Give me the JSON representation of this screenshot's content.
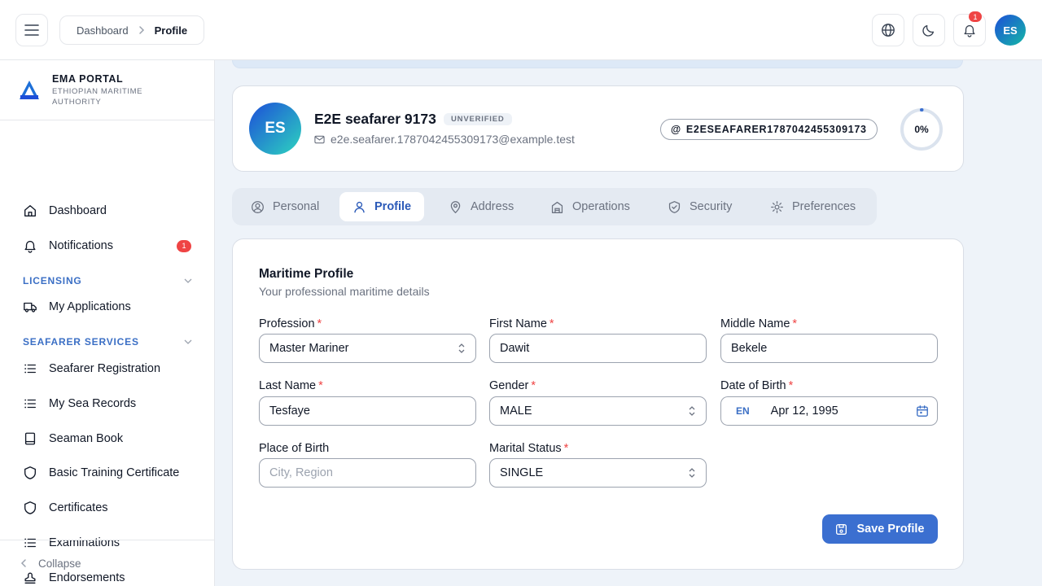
{
  "header": {
    "breadcrumb": [
      {
        "label": "Dashboard"
      },
      {
        "label": "Profile"
      }
    ],
    "notification_count": "1",
    "avatar_initials": "ES"
  },
  "sidebar": {
    "brand": {
      "name": "EMA PORTAL",
      "subtitle_line1": "ETHIOPIAN MARITIME",
      "subtitle_line2": "AUTHORITY"
    },
    "items": [
      {
        "label": "Dashboard",
        "icon": "home-icon"
      },
      {
        "label": "Notifications",
        "icon": "bell-icon",
        "badge": "1"
      },
      {
        "label": "My Applications",
        "icon": "truck-icon"
      },
      {
        "label": "Seafarer Registration",
        "icon": "list-icon"
      },
      {
        "label": "My Sea Records",
        "icon": "list-icon"
      },
      {
        "label": "Seaman Book",
        "icon": "book-icon"
      },
      {
        "label": "Basic Training Certificate",
        "icon": "shield-icon"
      },
      {
        "label": "Certificates",
        "icon": "shield-icon"
      },
      {
        "label": "Examinations",
        "icon": "list-icon"
      },
      {
        "label": "Endorsements",
        "icon": "stamp-icon"
      }
    ],
    "sections": [
      {
        "label": "LICENSING"
      },
      {
        "label": "SEAFARER SERVICES"
      }
    ],
    "collapse_label": "Collapse"
  },
  "profile": {
    "initials": "ES",
    "name": "E2E seafarer 9173",
    "status": "UNVERIFIED",
    "email": "e2e.seafarer.1787042455309173@example.test",
    "username": "E2ESEAFARER1787042455309173",
    "completion": "0%",
    "completion_value": 0
  },
  "tabs": [
    {
      "label": "Personal",
      "icon": "user-circle-icon"
    },
    {
      "label": "Profile",
      "icon": "user-icon",
      "active": true
    },
    {
      "label": "Address",
      "icon": "map-pin-icon"
    },
    {
      "label": "Operations",
      "icon": "building-icon"
    },
    {
      "label": "Security",
      "icon": "shield-check-icon"
    },
    {
      "label": "Preferences",
      "icon": "gear-icon"
    }
  ],
  "form": {
    "title": "Maritime Profile",
    "subtitle": "Your professional maritime details",
    "fields": {
      "profession": {
        "label": "Profession",
        "value": "Master Mariner"
      },
      "first_name": {
        "label": "First Name",
        "value": "Dawit"
      },
      "middle_name": {
        "label": "Middle Name",
        "value": "Bekele"
      },
      "last_name": {
        "label": "Last Name",
        "value": "Tesfaye"
      },
      "gender": {
        "label": "Gender",
        "value": "MALE"
      },
      "dob": {
        "label": "Date of Birth",
        "lang": "EN",
        "value": "Apr 12, 1995"
      },
      "place_of_birth": {
        "label": "Place of Birth",
        "placeholder": "City, Region"
      },
      "marital_status": {
        "label": "Marital Status",
        "value": "SINGLE"
      }
    },
    "save_label": "Save Profile"
  }
}
